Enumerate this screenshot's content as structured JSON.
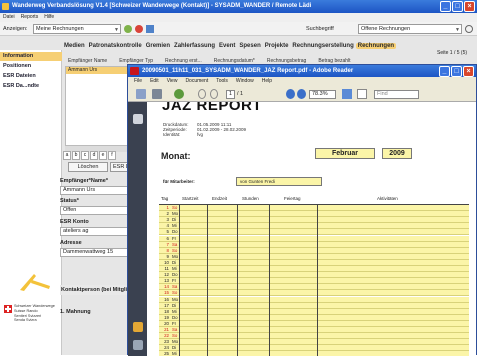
{
  "app": {
    "title": "Wanderweg Verbandslösung V1.4 [Schweizer Wanderwege (Kontakt)] - SYSADM_WANDER / Remote Lädi",
    "menu": [
      "Datei",
      "Reports",
      "Hilfe"
    ],
    "anzeigen_label": "Anzeigen:",
    "anzeigen_value": "Meine Rechnungen",
    "suchbegriff_label": "Suchbegriff",
    "suchbegriff_value": "Offene Rechnungen",
    "tabs": [
      "Medien",
      "Patronatskontrolle",
      "Gremien",
      "Zahlerfassung",
      "Event",
      "Spesen",
      "Projekte",
      "Rechnungserstellung",
      "Rechnungen"
    ],
    "active_tab": "Rechnungen",
    "sidebar": [
      "Information",
      "Positionen",
      "ESR Dateien",
      "ESR Da...ndte"
    ],
    "list_columns": [
      "Empfänger Name",
      "Empfänger Typ",
      "Rechnung erst...",
      "Rechnungsdatum*",
      "Rechnungsbetrag",
      "Betrag bezahlt"
    ],
    "seite": "Seite 1 / 5 (5)",
    "selected_row": "Ammann Urs",
    "letters": [
      "a",
      "b",
      "c",
      "d",
      "e",
      "f"
    ],
    "btn_loschen": "Löschen",
    "btn_esr": "ESR Datei",
    "fields": {
      "empfaenger_label": "Empfänger*Name*",
      "empfaenger_value": "Ammann Urs",
      "status_label": "Status*",
      "status_value": "Offen",
      "esr_label": "ESR Konto",
      "esr_value": "ateliers ag",
      "adresse_label": "Adresse",
      "adresse_value": "Dammenwattweg 15",
      "kontakt_label": "Kontaktperson (bei Mitglied)",
      "mahnung_label": "1. Mahnung"
    },
    "logo_text": [
      "Schweizer Wanderwege",
      "Suisse Rando",
      "Sentieri Svizzeri",
      "Senda Svizra"
    ]
  },
  "reader": {
    "title": "20090501_11h11_031_SYSADM_WANDER_JAZ Report.pdf - Adobe Reader",
    "menu": [
      "File",
      "Edit",
      "View",
      "Document",
      "Tools",
      "Window",
      "Help"
    ],
    "page": "1",
    "page_total": "/ 1",
    "zoom": "78.3%",
    "find_placeholder": "Find"
  },
  "report": {
    "title": "JAZ REPORT",
    "druckdatum_label": "Druckdatum:",
    "druckdatum_value": "01.05.2009 11:11",
    "zeitperiode_label": "Zeitperiode:",
    "zeitperiode_value": "01.02.2009 - 28.02.2009",
    "identitaet_label": "Identität:",
    "identitaet_value": "fvg",
    "monat_label": "Monat:",
    "monat_value": "Februar",
    "jahr_value": "2009",
    "mitarbeiter_label": "für Mitarbeiter:",
    "mitarbeiter_value": "von Gunten Fredi",
    "columns": [
      "Tag",
      "Startzeit",
      "Endzeit",
      "Stunden",
      "Feiertag",
      "Aktivitäten"
    ],
    "days": [
      {
        "n": "1",
        "d": "So",
        "we": true
      },
      {
        "n": "2",
        "d": "Mo",
        "we": false
      },
      {
        "n": "3",
        "d": "Di",
        "we": false
      },
      {
        "n": "4",
        "d": "Mi",
        "we": false
      },
      {
        "n": "5",
        "d": "Do",
        "we": false
      },
      {
        "n": "6",
        "d": "Fr",
        "we": false
      },
      {
        "n": "7",
        "d": "Sa",
        "we": true
      },
      {
        "n": "8",
        "d": "So",
        "we": true
      },
      {
        "n": "9",
        "d": "Mo",
        "we": false
      },
      {
        "n": "10",
        "d": "Di",
        "we": false
      },
      {
        "n": "11",
        "d": "Mi",
        "we": false
      },
      {
        "n": "12",
        "d": "Do",
        "we": false
      },
      {
        "n": "13",
        "d": "Fr",
        "we": false
      },
      {
        "n": "14",
        "d": "Sa",
        "we": true
      },
      {
        "n": "15",
        "d": "So",
        "we": true
      },
      {
        "n": "16",
        "d": "Mo",
        "we": false
      },
      {
        "n": "17",
        "d": "Di",
        "we": false
      },
      {
        "n": "18",
        "d": "Mi",
        "we": false
      },
      {
        "n": "19",
        "d": "Do",
        "we": false
      },
      {
        "n": "20",
        "d": "Fr",
        "we": false
      },
      {
        "n": "21",
        "d": "Sa",
        "we": true
      },
      {
        "n": "22",
        "d": "So",
        "we": true
      },
      {
        "n": "23",
        "d": "Mo",
        "we": false
      },
      {
        "n": "24",
        "d": "Di",
        "we": false
      },
      {
        "n": "25",
        "d": "Mi",
        "we": false
      }
    ]
  },
  "colors": {
    "accent": "#f6cf74",
    "report_fill": "#fbf5a8",
    "weekend_text": "#d01c1c",
    "titlebar": "#1d55c4"
  }
}
